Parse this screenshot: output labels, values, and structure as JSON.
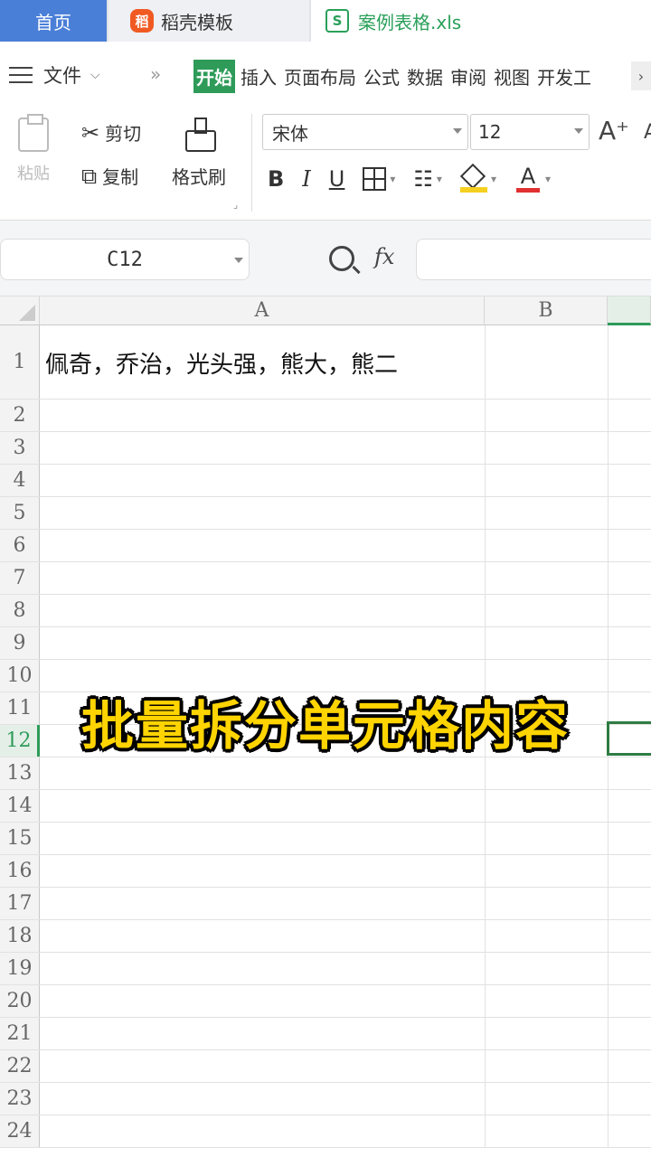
{
  "tabs": {
    "home": "首页",
    "docer": "稻壳模板",
    "file": "案例表格.xls"
  },
  "menu": {
    "file": "文件",
    "more": "»",
    "ribbon": [
      "开始",
      "插入",
      "页面布局",
      "公式",
      "数据",
      "审阅",
      "视图",
      "开发工"
    ],
    "active": "开始",
    "scroll_right": "›"
  },
  "toolbar": {
    "paste": "粘贴",
    "cut": "剪切",
    "copy": "复制",
    "format_painter": "格式刷",
    "font": "宋体",
    "font_size": "12",
    "grow_font": "A⁺",
    "shrink_font": "A",
    "bold": "B",
    "italic": "I",
    "underline": "U",
    "font_color_glyph": "A"
  },
  "formula_bar": {
    "name_box": "C12",
    "fx": "fx",
    "value": ""
  },
  "grid": {
    "columns": [
      "A",
      "B"
    ],
    "rows": [
      "1",
      "2",
      "3",
      "4",
      "5",
      "6",
      "7",
      "8",
      "9",
      "10",
      "11",
      "12",
      "13",
      "14",
      "15",
      "16",
      "17",
      "18",
      "19",
      "20",
      "21",
      "22",
      "23",
      "24"
    ],
    "selected_row": "12",
    "cell_A1": "佩奇，乔治，光头强，熊大，熊二"
  },
  "overlay": {
    "caption": "批量拆分单元格内容"
  },
  "colors": {
    "accent": "#2e9b59",
    "home_tab": "#4a7fd8",
    "caption": "#ffd400"
  }
}
